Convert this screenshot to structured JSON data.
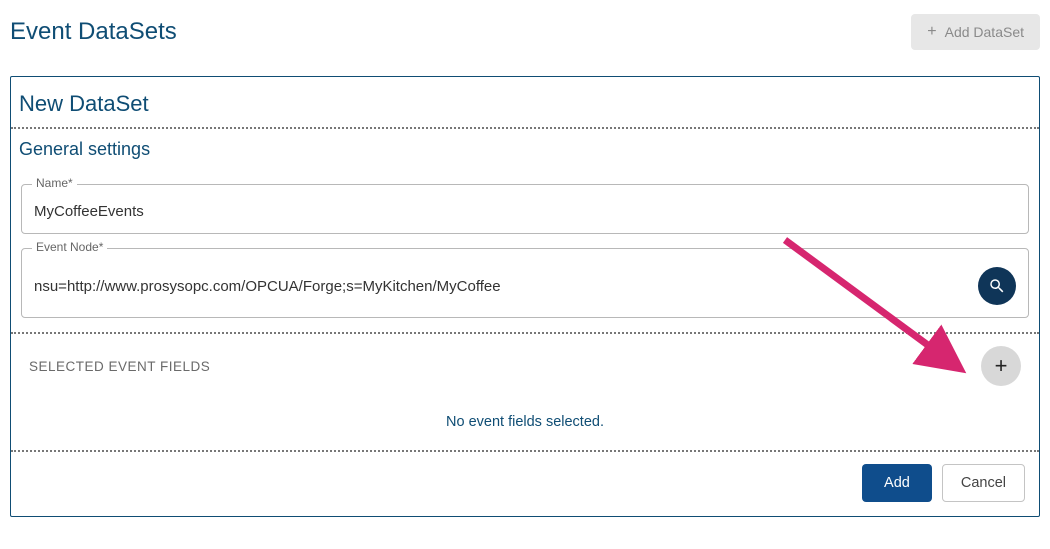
{
  "header": {
    "title": "Event DataSets",
    "add_button_label": "Add DataSet"
  },
  "card": {
    "title": "New DataSet",
    "general_settings_label": "General settings",
    "name_label": "Name*",
    "name_value": "MyCoffeeEvents",
    "event_node_label": "Event Node*",
    "event_node_value": "nsu=http://www.prosysopc.com/OPCUA/Forge;s=MyKitchen/MyCoffee",
    "selected_fields_label": "SELECTED EVENT FIELDS",
    "empty_message": "No event fields selected.",
    "add_label": "Add",
    "cancel_label": "Cancel"
  },
  "colors": {
    "brand": "#0f4d74",
    "accent_arrow": "#d6266f",
    "primary_btn": "#0f4d8c",
    "search_btn_bg": "#0f3558"
  }
}
